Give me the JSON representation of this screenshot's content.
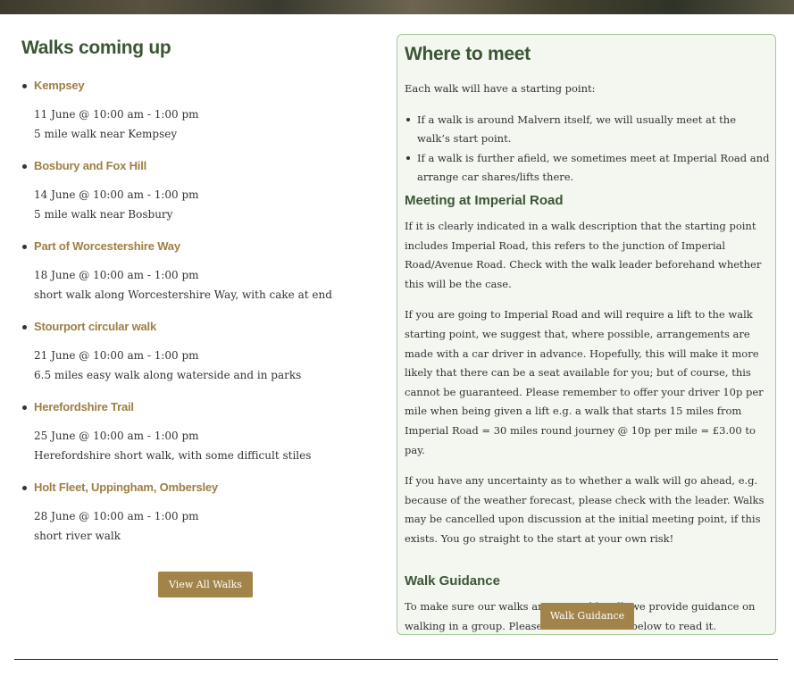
{
  "walks_section": {
    "title": "Walks coming up",
    "items": [
      {
        "title": "Kempsey",
        "when": "11 June @ 10:00 am - 1:00 pm",
        "desc": "5 mile walk near Kempsey"
      },
      {
        "title": "Bosbury and Fox Hill",
        "when": "14 June @ 10:00 am - 1:00 pm",
        "desc": "5 mile walk near Bosbury"
      },
      {
        "title": "Part of Worcestershire Way",
        "when": "18 June @ 10:00 am - 1:00 pm",
        "desc": "short walk along Worcestershire Way, with cake at end"
      },
      {
        "title": "Stourport circular walk",
        "when": "21 June @ 10:00 am - 1:00 pm",
        "desc": "6.5 miles easy walk along waterside and in parks"
      },
      {
        "title": "Herefordshire Trail",
        "when": "25 June @ 10:00 am - 1:00 pm",
        "desc": "Herefordshire short walk, with some difficult stiles"
      },
      {
        "title": "Holt Fleet, Uppingham, Ombersley",
        "when": "28 June @ 10:00 am - 1:00 pm",
        "desc": "short river walk"
      }
    ],
    "button_label": "View All Walks"
  },
  "meet_panel": {
    "title": "Where to meet",
    "intro": "Each walk will have a starting point:",
    "bullets": [
      "If a walk is around Malvern itself, we will usually meet at the walk’s start point.",
      "If a walk is further afield, we sometimes meet at Imperial Road and arrange car shares/lifts there."
    ],
    "imperial_heading": "Meeting at Imperial Road",
    "imperial_p1": "If it is clearly indicated in a walk description that the starting point includes Imperial Road, this refers to the junction of Imperial Road/Avenue Road. Check with the walk leader beforehand whether this will be the case.",
    "imperial_p2": "If you are going to Imperial Road and will require a lift to the walk starting point, we suggest that, where possible, arrangements are made with a car driver in advance. Hopefully, this will make it more likely that there can be a seat available for you; but of course, this cannot be guaranteed. Please remember to offer your driver 10p per mile when being given a lift e.g. a walk that starts 15 miles from Imperial Road = 30 miles round journey @ 10p per mile = £3.00 to pay.",
    "imperial_p3": "If you have any uncertainty as to whether a walk will go ahead, e.g. because of the weather forecast, please check with the leader. Walks may be cancelled upon discussion at the initial meeting point, if this exists. You go straight to the start at your own risk!",
    "guidance_heading": "Walk Guidance",
    "guidance_p": "To make sure our walks are enjoyed by all, we provide guidance on walking in a group. Please click the button below to read it.",
    "button_label": "Walk Guidance"
  }
}
